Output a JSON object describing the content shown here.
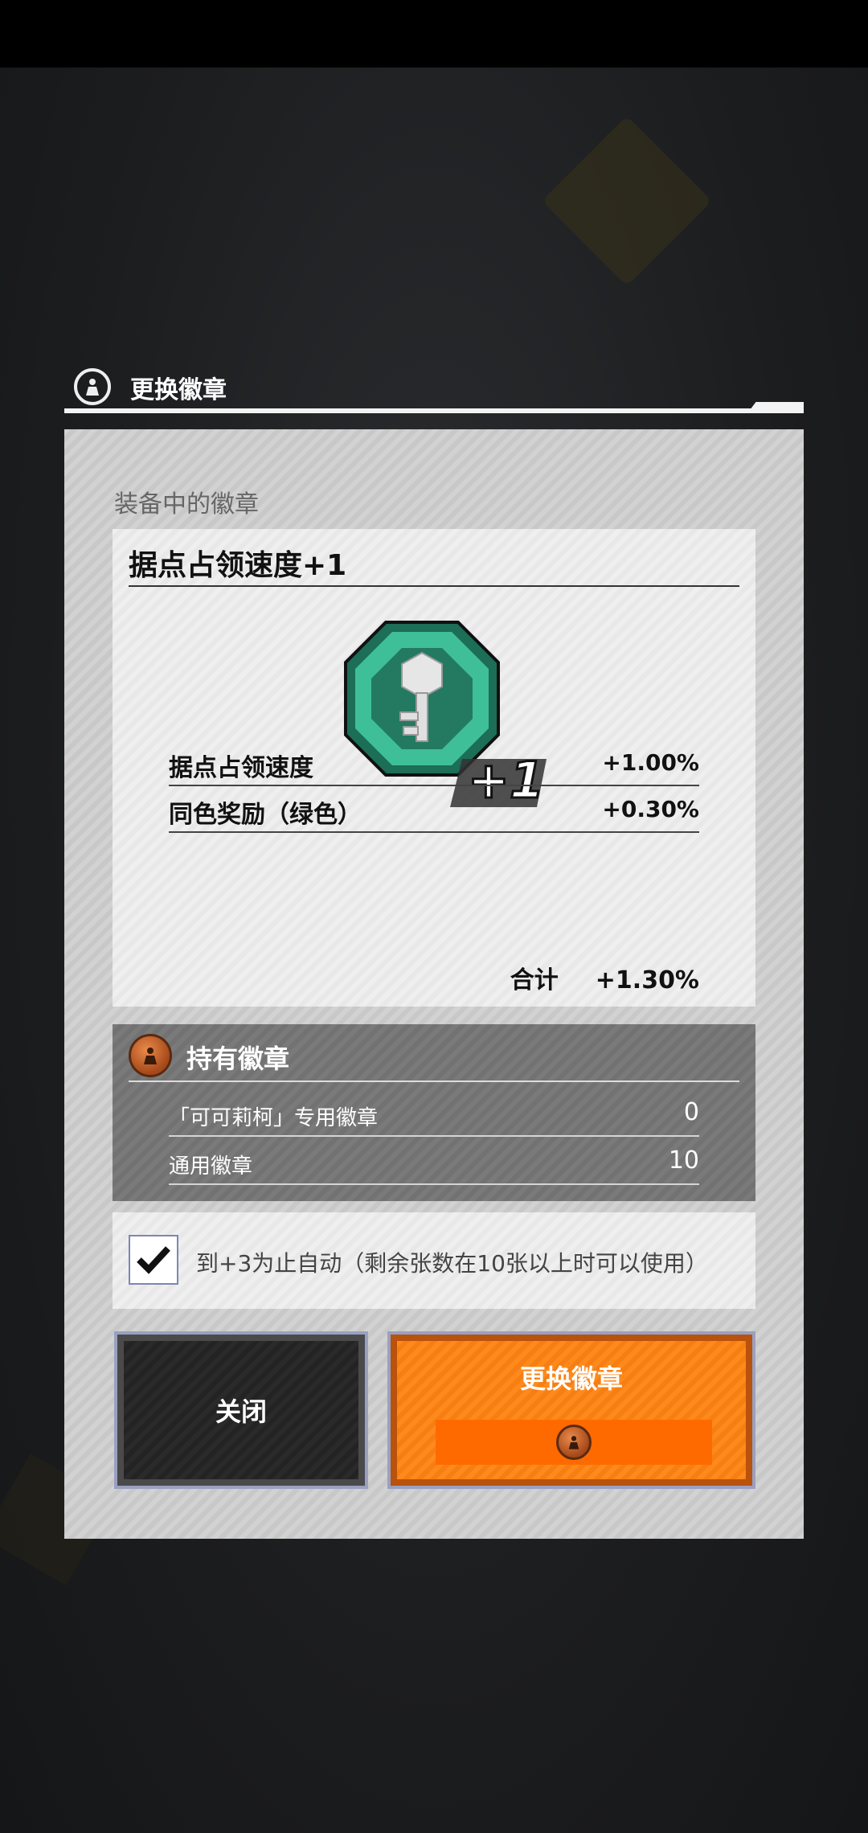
{
  "dialog": {
    "title": "更换徽章"
  },
  "equipped": {
    "section_label": "装备中的徽章",
    "badge_name": "据点占领速度+1",
    "badge_level": "+1",
    "badge_icon": "key-icon",
    "stats": [
      {
        "label": "据点占领速度",
        "value": "+1.00%"
      },
      {
        "label": "同色奖励（绿色）",
        "value": "+0.30%"
      }
    ],
    "total_label": "合计",
    "total_value": "+1.30%"
  },
  "owned": {
    "title": "持有徽章",
    "rows": [
      {
        "label": "「可可莉柯」专用徽章",
        "value": "0"
      },
      {
        "label": "通用徽章",
        "value": "10"
      }
    ]
  },
  "auto": {
    "checked": true,
    "text": "到+3为止自动（剩余张数在10张以上时可以使用）"
  },
  "buttons": {
    "close_label": "关闭",
    "swap_label": "更换徽章"
  },
  "colors": {
    "accent_orange": "#ff8a1c",
    "badge_green": "#2e9e7e",
    "badge_bronze": "#c86a32"
  }
}
